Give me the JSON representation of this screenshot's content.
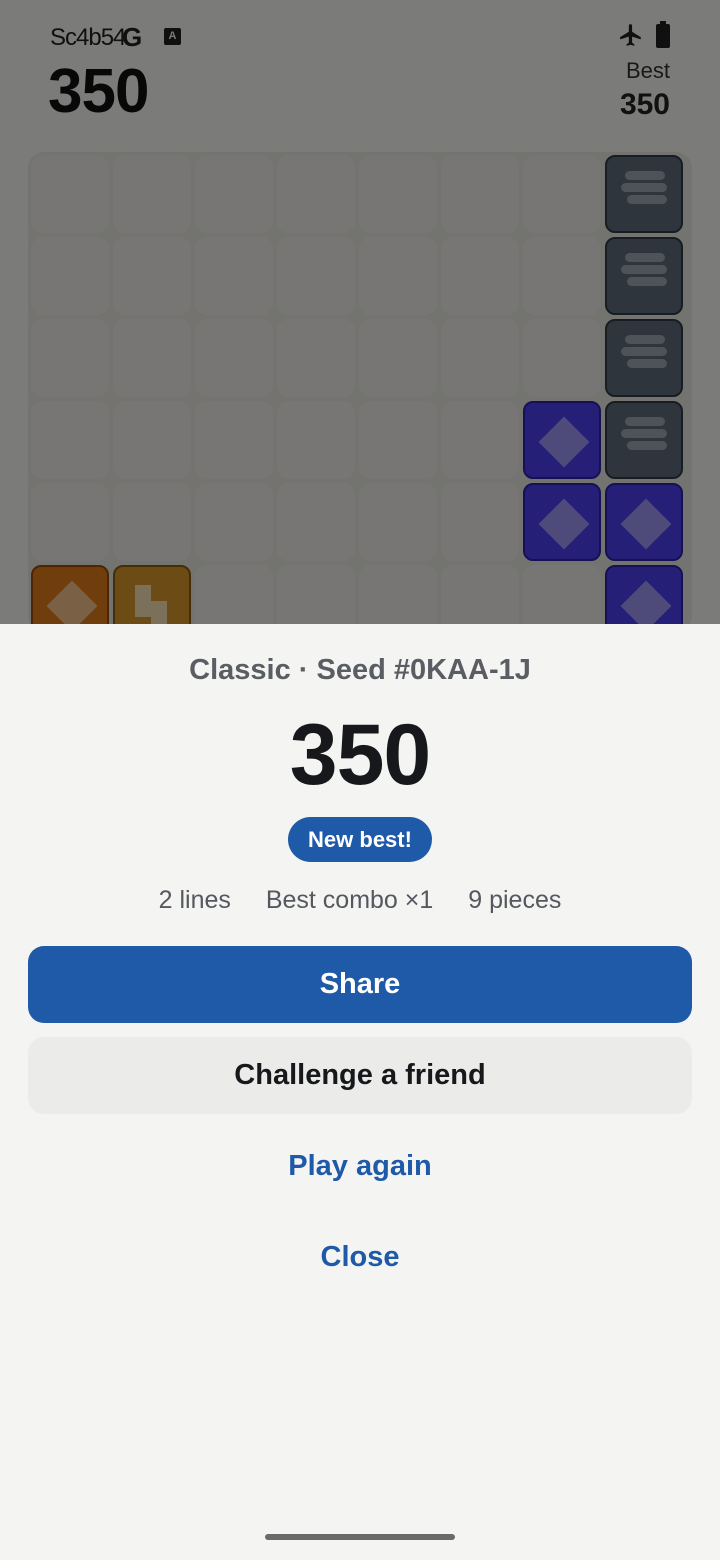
{
  "status_bar": {
    "time": "Sc4b54",
    "google_glyph": "G",
    "a_glyph": "A",
    "icons": [
      "airplane-mode-icon",
      "battery-icon"
    ]
  },
  "game": {
    "score": "350",
    "best_label": "Best",
    "best_value": "350"
  },
  "sheet": {
    "subtitle": "Classic · Seed #0KAA-1J",
    "score": "350",
    "badge": "New best!",
    "stats": [
      "2 lines",
      "Best combo ×1",
      "9 pieces"
    ],
    "share_label": "Share",
    "challenge_label": "Challenge a friend",
    "play_again_label": "Play again",
    "close_label": "Close"
  },
  "colors": {
    "accent": "#1e5aa8",
    "slate_tile": "#5d6b78",
    "purple_tile": "#4a3ff0",
    "orange_tile": "#e07a1a",
    "gold_tile": "#d9962a"
  }
}
